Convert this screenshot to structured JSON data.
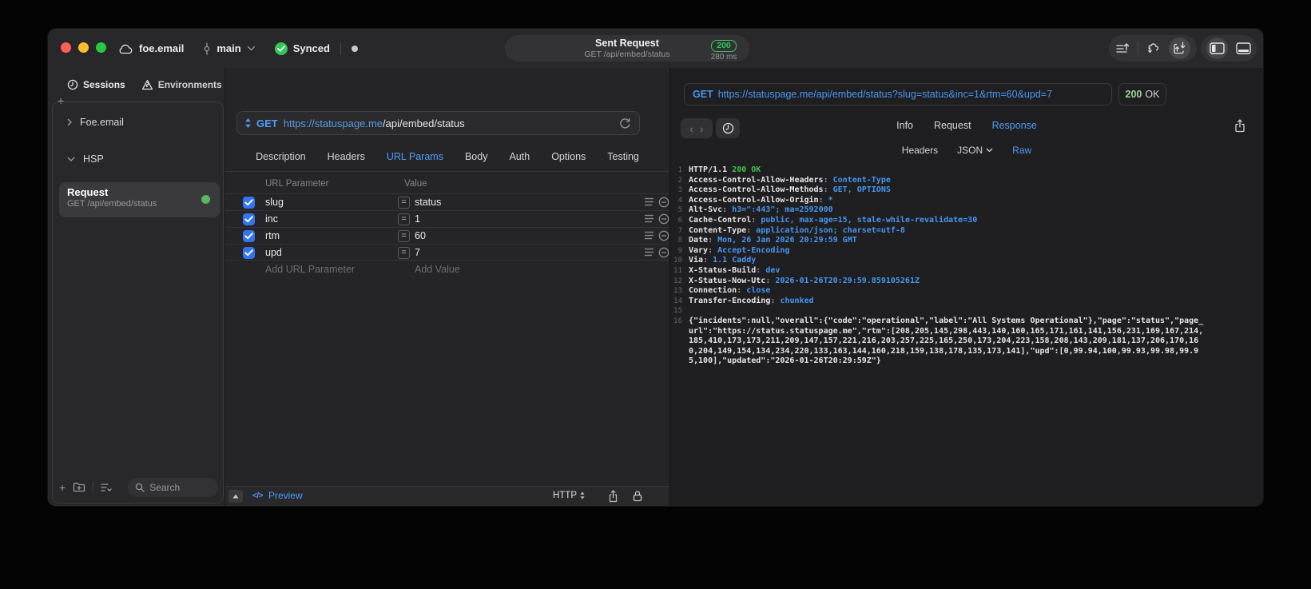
{
  "titlebar": {
    "project": "foe.email",
    "branch": "main",
    "sync_label": "Synced",
    "request_summary": {
      "title": "Sent Request",
      "subtitle": "GET /api/embed/status",
      "status": "200",
      "time": "280 ms"
    }
  },
  "sidebar": {
    "tabs": [
      {
        "label": "Sessions",
        "icon": "clock-icon"
      },
      {
        "label": "Environments",
        "icon": "environments-icon"
      }
    ],
    "tree": [
      {
        "label": "Foe.email",
        "state": "collapsed"
      },
      {
        "label": "HSP",
        "state": "expanded"
      }
    ],
    "request_item": {
      "title": "Request",
      "subtitle": "GET /api/embed/status"
    },
    "search_placeholder": "Search"
  },
  "request": {
    "method": "GET",
    "url_host": "https://statuspage.me",
    "url_path": "/api/embed/status",
    "tabs": [
      "Description",
      "Headers",
      "URL Params",
      "Body",
      "Auth",
      "Options",
      "Testing"
    ],
    "active_tab": "URL Params",
    "table": {
      "col_param": "URL Parameter",
      "col_value": "Value",
      "rows": [
        {
          "name": "slug",
          "value": "status",
          "checked": true
        },
        {
          "name": "inc",
          "value": "1",
          "checked": true
        },
        {
          "name": "rtm",
          "value": "60",
          "checked": true
        },
        {
          "name": "upd",
          "value": "7",
          "checked": true
        }
      ],
      "add_param_label": "Add URL Parameter",
      "add_value_label": "Add Value"
    },
    "footer": {
      "preview_label": "Preview",
      "preview_icon": "</>",
      "protocol": "HTTP"
    }
  },
  "response": {
    "request_line": {
      "method": "GET",
      "url": "https://statuspage.me/api/embed/status?slug=status&inc=1&rtm=60&upd=7"
    },
    "status_code": "200",
    "status_text": "OK",
    "tabs": [
      "Info",
      "Request",
      "Response"
    ],
    "active_tab": "Response",
    "subtabs": [
      "Headers",
      "JSON",
      "Raw"
    ],
    "active_subtab": "Raw",
    "raw": {
      "status_line": {
        "protocol": "HTTP/1.1",
        "status": "200 OK"
      },
      "headers": [
        {
          "key": "Access-Control-Allow-Headers",
          "value": "Content-Type"
        },
        {
          "key": "Access-Control-Allow-Methods",
          "value": "GET, OPTIONS"
        },
        {
          "key": "Access-Control-Allow-Origin",
          "value": "*"
        },
        {
          "key": "Alt-Svc",
          "value": "h3=\":443\"; ma=2592000"
        },
        {
          "key": "Cache-Control",
          "value": "public, max-age=15, stale-while-revalidate=30"
        },
        {
          "key": "Content-Type",
          "value": "application/json; charset=utf-8"
        },
        {
          "key": "Date",
          "value": "Mon, 26 Jan 2026 20:29:59 GMT"
        },
        {
          "key": "Vary",
          "value": "Accept-Encoding"
        },
        {
          "key": "Via",
          "value": "1.1 Caddy"
        },
        {
          "key": "X-Status-Build",
          "value": "dev"
        },
        {
          "key": "X-Status-Now-Utc",
          "value": "2026-01-26T20:29:59.859105261Z"
        },
        {
          "key": "Connection",
          "value": "close"
        },
        {
          "key": "Transfer-Encoding",
          "value": "chunked"
        }
      ],
      "body_line_number": 16,
      "body": "{\"incidents\":null,\"overall\":{\"code\":\"operational\",\"label\":\"All Systems Operational\"},\"page\":\"status\",\"page_url\":\"https://status.statuspage.me\",\"rtm\":[208,205,145,298,443,140,160,165,171,161,141,156,231,169,167,214,185,410,173,173,211,209,147,157,221,216,203,257,225,165,250,173,204,223,158,208,143,209,181,137,206,170,160,204,149,154,134,234,220,133,163,144,160,218,159,138,178,135,173,141],\"upd\":[0,99.94,100,99.93,99.98,99.95,100],\"updated\":\"2026-01-26T20:29:59Z\"}"
    }
  },
  "colors": {
    "accent_blue": "#4f9cf8",
    "value_blue": "#4796ef",
    "status_green": "#34c759",
    "checkbox_blue": "#3574f0",
    "traffic_red": "#ff5f57",
    "traffic_yellow": "#febc2e",
    "traffic_green": "#28c840"
  }
}
